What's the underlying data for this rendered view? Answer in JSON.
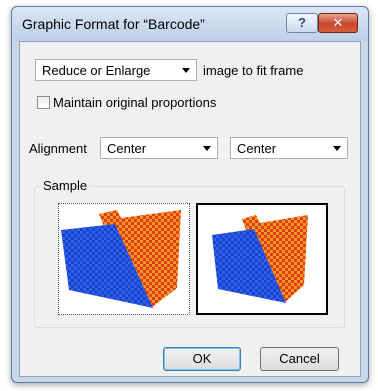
{
  "window": {
    "title": "Graphic Format for “Barcode”",
    "help_label": "?",
    "close_label": "✕"
  },
  "scaling": {
    "selected": "Reduce or Enlarge",
    "suffix": "image to fit frame"
  },
  "proportions": {
    "label": "Maintain original proportions",
    "checked": false
  },
  "alignment": {
    "label": "Alignment",
    "horizontal": "Center",
    "vertical": "Center"
  },
  "sample": {
    "label": "Sample",
    "colors": {
      "blue": "#1f3fd0",
      "orange": "#f29a1e",
      "red": "#e23a1a"
    }
  },
  "buttons": {
    "ok": "OK",
    "cancel": "Cancel"
  }
}
